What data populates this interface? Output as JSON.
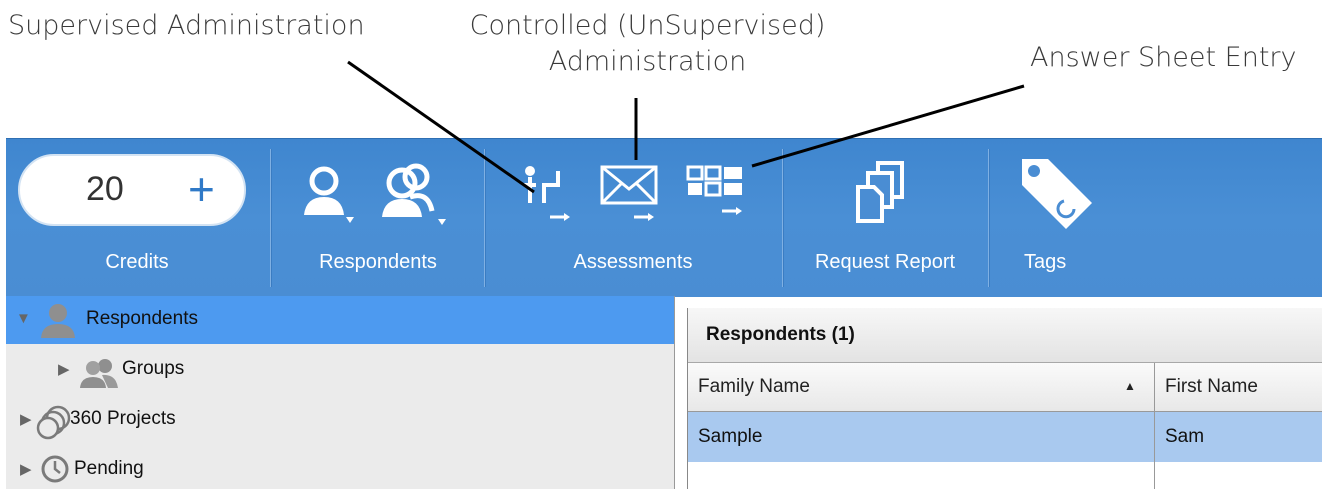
{
  "callouts": {
    "supervised": "Supervised Administration",
    "controlled_line1": "Controlled (UnSupervised)",
    "controlled_line2": "Administration",
    "answer_sheet": "Answer Sheet Entry"
  },
  "toolbar": {
    "credits": {
      "value": "20",
      "plus": "+",
      "label": "Credits"
    },
    "respondents": {
      "label": "Respondents",
      "icons": [
        "person-icon",
        "people-icon"
      ]
    },
    "assessments": {
      "label": "Assessments",
      "icons": [
        "supervised-admin-icon",
        "envelope-icon",
        "answer-sheet-grid-icon"
      ]
    },
    "request_report": {
      "label": "Request Report",
      "icon": "documents-stack-icon"
    },
    "tags": {
      "label": "Tags",
      "icon": "tag-icon"
    },
    "colors": {
      "background": "#4a8dd3",
      "selected": "#4d9af0"
    }
  },
  "tree": {
    "items": [
      {
        "label": "Respondents",
        "icon": "person-icon",
        "expanded": true,
        "selected": true
      },
      {
        "label": "Groups",
        "icon": "people-icon",
        "expanded": false,
        "selected": false
      },
      {
        "label": "360 Projects",
        "icon": "circles-icon",
        "expanded": false,
        "selected": false
      },
      {
        "label": "Pending",
        "icon": "clock-icon",
        "expanded": false,
        "selected": false
      }
    ]
  },
  "pane": {
    "title": "Respondents (1)",
    "columns": [
      "Family Name",
      "First Name"
    ],
    "sort_indicator": "▲",
    "rows": [
      {
        "family_name": "Sample",
        "first_name": "Sam"
      }
    ]
  }
}
